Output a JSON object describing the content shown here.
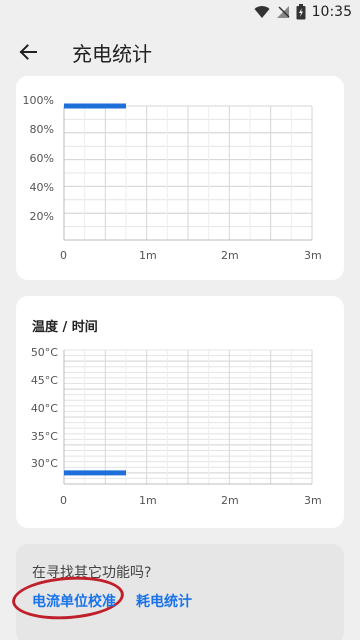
{
  "status_bar": {
    "time": "10:35"
  },
  "app_bar": {
    "title": "充电统计"
  },
  "chart1": {
    "y_ticks": [
      "100%",
      "80%",
      "60%",
      "40%",
      "20%"
    ],
    "x_ticks": [
      "0",
      "1m",
      "2m",
      "3m"
    ]
  },
  "chart2": {
    "title": "温度 / 时间",
    "y_ticks": [
      "50°C",
      "45°C",
      "40°C",
      "35°C",
      "30°C"
    ],
    "x_ticks": [
      "0",
      "1m",
      "2m",
      "3m"
    ]
  },
  "bottom": {
    "hint": "在寻找其它功能吗?",
    "link_calibration": "电流单位校准",
    "link_consumption": "耗电统计"
  },
  "colors": {
    "series": "#1e6fd9",
    "link": "#1a73e8",
    "annotation": "#c0202a"
  },
  "chart_data": [
    {
      "type": "line",
      "xlabel": "",
      "ylabel": "",
      "x_ticks": [
        "0",
        "1m",
        "2m",
        "3m"
      ],
      "y_ticks": [
        "20%",
        "40%",
        "60%",
        "80%",
        "100%"
      ],
      "ylim": [
        0,
        100
      ],
      "xlim_minutes": [
        0,
        3
      ],
      "series": [
        {
          "x_minutes": [
            0,
            0.75
          ],
          "values": [
            100,
            100
          ]
        }
      ],
      "grid": true
    },
    {
      "type": "line",
      "title": "温度 / 时间",
      "x_ticks": [
        "0",
        "1m",
        "2m",
        "3m"
      ],
      "y_ticks": [
        "30°C",
        "35°C",
        "40°C",
        "45°C",
        "50°C"
      ],
      "ylim": [
        28,
        52
      ],
      "xlim_minutes": [
        0,
        3
      ],
      "series": [
        {
          "x_minutes": [
            0,
            0.75
          ],
          "values": [
            30,
            30
          ]
        }
      ],
      "grid": true
    }
  ]
}
